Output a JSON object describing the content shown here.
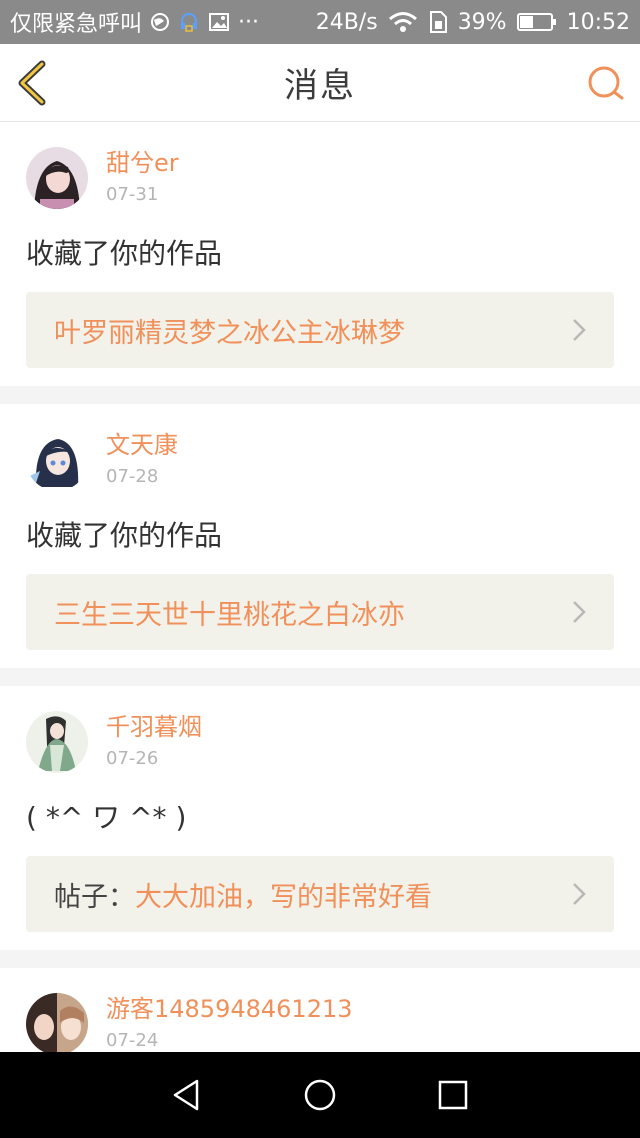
{
  "status_bar": {
    "carrier": "仅限紧急呼叫",
    "dots": "···",
    "speed": "24B/s",
    "battery": "39%",
    "time": "10:52"
  },
  "header": {
    "title": "消息"
  },
  "colors": {
    "accent": "#f0905a",
    "link_bg": "#f3f2ea",
    "page_bg": "#f4f4f4"
  },
  "messages": [
    {
      "username": "甜兮er",
      "date": "07-31",
      "text": "收藏了你的作品",
      "link_prefix": "",
      "link_text": "叶罗丽精灵梦之冰公主冰琳梦"
    },
    {
      "username": "文天康",
      "date": "07-28",
      "text": "收藏了你的作品",
      "link_prefix": "",
      "link_text": "三生三天世十里桃花之白冰亦"
    },
    {
      "username": "千羽暮烟",
      "date": "07-26",
      "text": "( *^ ワ ^* )",
      "link_prefix": "帖子：",
      "link_text": "大大加油，写的非常好看"
    },
    {
      "username": "游客1485948461213",
      "date": "07-24"
    }
  ]
}
